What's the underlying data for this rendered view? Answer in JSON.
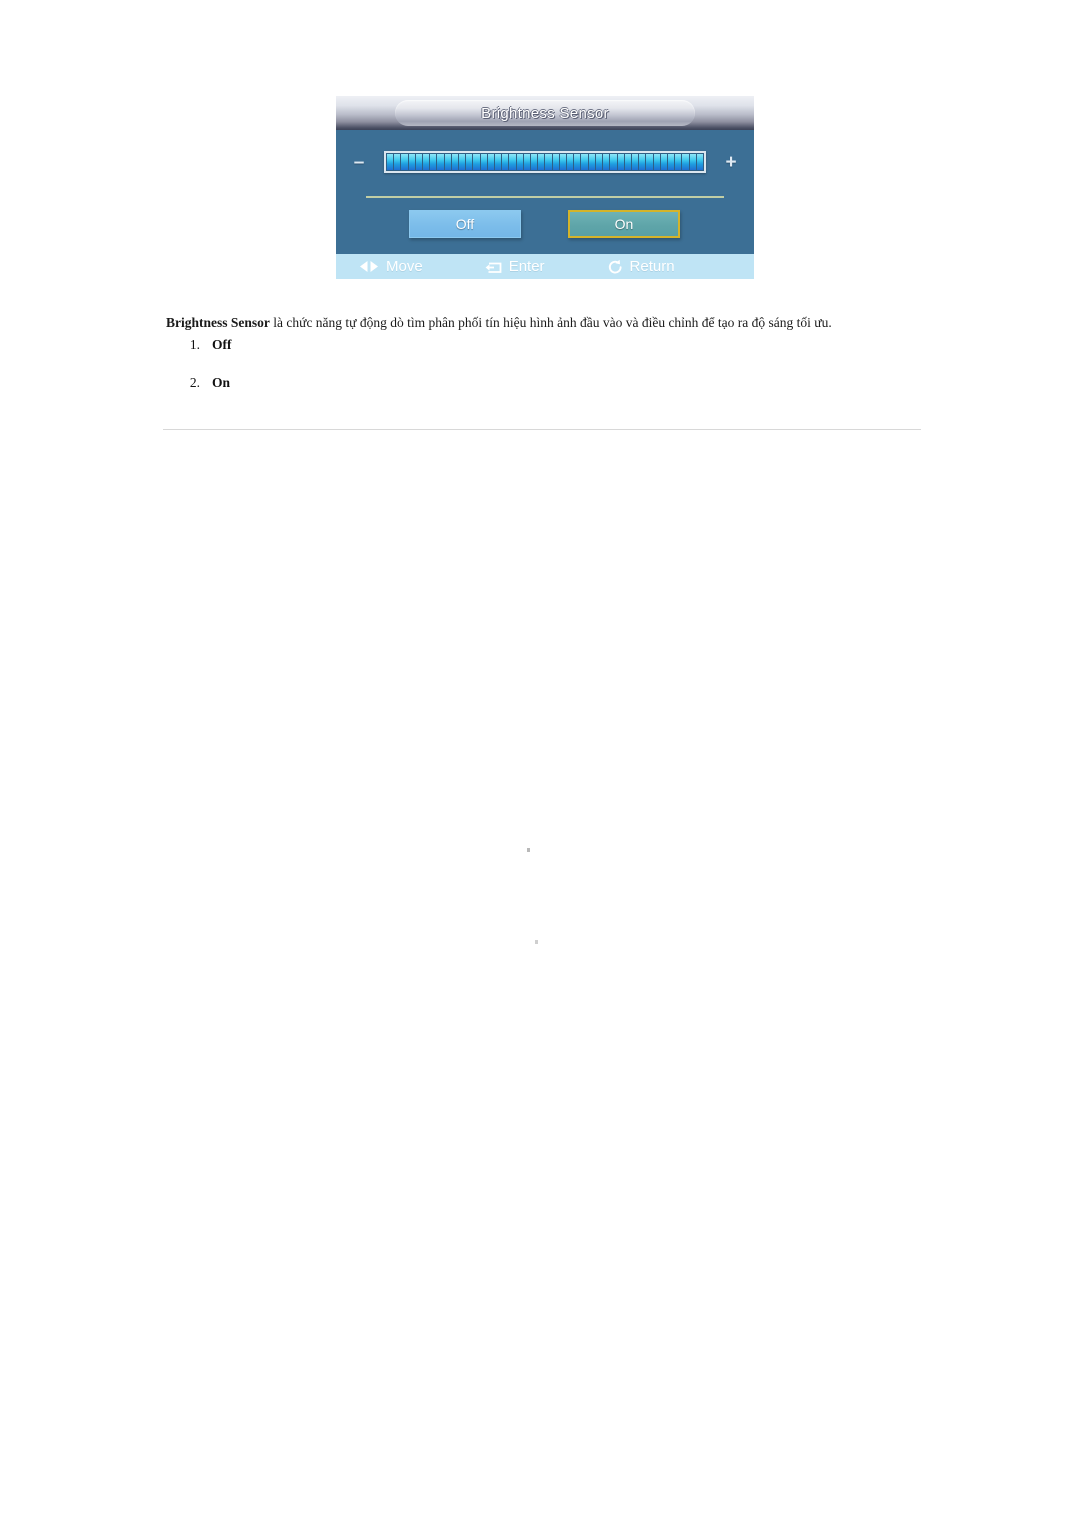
{
  "osd": {
    "title": "Brightness Sensor",
    "slider": {
      "minus_label": "–",
      "plus_label": "+",
      "segments": 44,
      "value_percent": 100
    },
    "options": [
      {
        "label": "Off",
        "selected": false
      },
      {
        "label": "On",
        "selected": true
      }
    ],
    "statusbar": [
      {
        "icon": "left-right-arrows-icon",
        "label": "Move"
      },
      {
        "icon": "enter-key-icon",
        "label": "Enter"
      },
      {
        "icon": "return-arrow-icon",
        "label": "Return"
      }
    ],
    "colors": {
      "panel_body": "#3c6f95",
      "statusbar": "#bfe4f5",
      "button_off": "#7cbdea",
      "button_on": "#5fa5a9",
      "selection_border": "#d4b42a",
      "divider": "#d8dfa8",
      "segment_top": "#8fe6f7",
      "segment_bottom": "#1f6fd2"
    }
  },
  "document": {
    "paragraph_bold_lead": "Brightness Sensor",
    "paragraph_rest": " là chức năng tự động dò tìm phân phối tín hiệu hình ảnh đầu vào và điều chỉnh để tạo ra độ sáng tối ưu.",
    "list": [
      {
        "number": "1.",
        "label": "Off"
      },
      {
        "number": "2.",
        "label": "On"
      }
    ]
  }
}
